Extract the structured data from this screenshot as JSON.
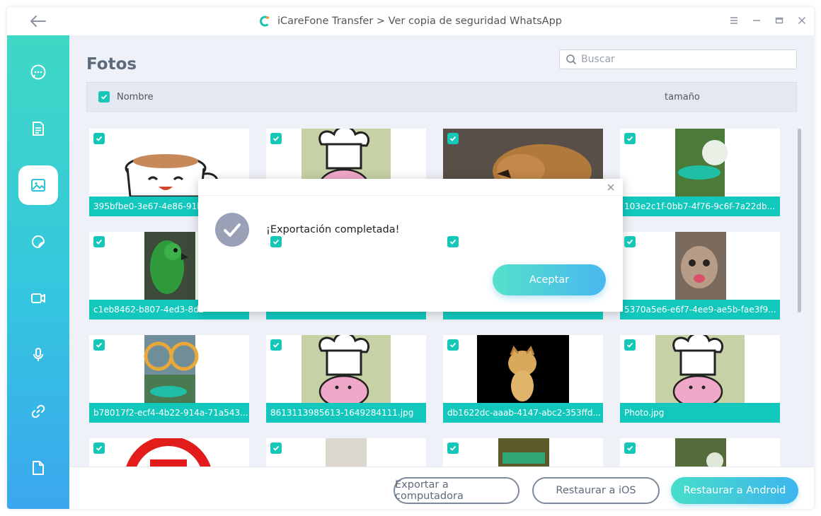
{
  "app": {
    "title": "iCareFone Transfer > Ver copia de seguridad WhatsApp"
  },
  "colors": {
    "accent": "#12c8bd",
    "sidebar_top": "#3fd8c4",
    "sidebar_bottom": "#3aa7ee",
    "check_circle": "#9aa0b6"
  },
  "sidebar": {
    "items": [
      {
        "icon": "chat-icon"
      },
      {
        "icon": "document-icon"
      },
      {
        "icon": "image-icon",
        "active": true
      },
      {
        "icon": "sticker-icon"
      },
      {
        "icon": "video-icon"
      },
      {
        "icon": "microphone-icon"
      },
      {
        "icon": "link-icon"
      },
      {
        "icon": "file-icon"
      }
    ]
  },
  "main": {
    "title": "Fotos",
    "search_placeholder": "Buscar",
    "columns": {
      "name": "Nombre",
      "size": "tamaño"
    }
  },
  "photos": [
    {
      "name": "395bfbe0-3e67-4e86-91b"
    },
    {
      "name": ""
    },
    {
      "name": ""
    },
    {
      "name": "103e2c1f-0bb7-4f76-9c6f-7a22db..."
    },
    {
      "name": "c1eb8462-b807-4ed3-8d2"
    },
    {
      "name": ""
    },
    {
      "name": ""
    },
    {
      "name": "5370a5e6-e6f7-4ee9-ae5b-fae3f9..."
    },
    {
      "name": "b78017f2-ecf4-4b22-914a-71a543..."
    },
    {
      "name": "8613113985613-1649284111.jpg"
    },
    {
      "name": "db1622dc-aaab-4147-abc2-353ffd..."
    },
    {
      "name": "Photo.jpg"
    },
    {
      "name": ""
    },
    {
      "name": ""
    },
    {
      "name": ""
    },
    {
      "name": ""
    }
  ],
  "footer": {
    "export_label": "Exportar a computadora",
    "restore_ios_label": "Restaurar a iOS",
    "restore_android_label": "Restaurar a Android"
  },
  "dialog": {
    "message": "¡Exportación completada!",
    "accept_label": "Aceptar"
  }
}
